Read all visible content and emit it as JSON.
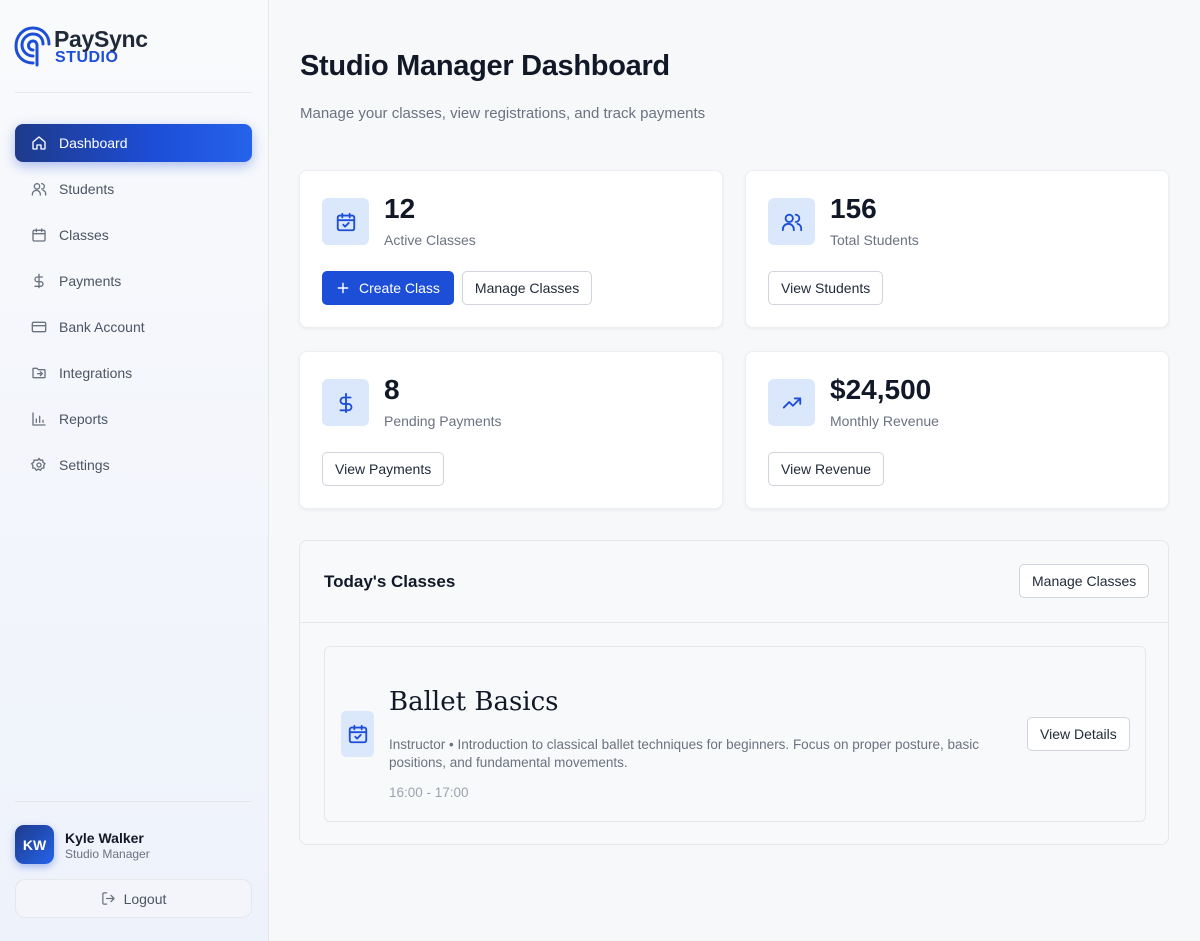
{
  "brand": {
    "name": "PaySync",
    "sub": "STUDIO",
    "accent": "#1d4ed8"
  },
  "sidebar": {
    "items": [
      {
        "label": "Dashboard",
        "icon": "home-icon",
        "active": true
      },
      {
        "label": "Students",
        "icon": "users-icon"
      },
      {
        "label": "Classes",
        "icon": "calendar-icon"
      },
      {
        "label": "Payments",
        "icon": "dollar-icon"
      },
      {
        "label": "Bank Account",
        "icon": "credit-card-icon"
      },
      {
        "label": "Integrations",
        "icon": "folder-icon"
      },
      {
        "label": "Reports",
        "icon": "bar-chart-icon"
      },
      {
        "label": "Settings",
        "icon": "gear-icon"
      }
    ]
  },
  "user": {
    "initials": "KW",
    "name": "Kyle Walker",
    "role": "Studio Manager",
    "logout_label": "Logout"
  },
  "header": {
    "title": "Studio Manager Dashboard",
    "subtitle": "Manage your classes, view registrations, and track payments"
  },
  "stats": {
    "classes": {
      "value": "12",
      "label": "Active Classes",
      "create_label": "Create Class",
      "manage_label": "Manage Classes"
    },
    "students": {
      "value": "156",
      "label": "Total Students",
      "view_label": "View Students"
    },
    "payments": {
      "value": "8",
      "label": "Pending Payments",
      "view_label": "View Payments"
    },
    "revenue": {
      "value": "$24,500",
      "label": "Monthly Revenue",
      "view_label": "View Revenue"
    }
  },
  "today": {
    "title": "Today's Classes",
    "manage_label": "Manage Classes",
    "classes": [
      {
        "title": "Ballet Basics",
        "description": "Instructor • Introduction to classical ballet techniques for beginners. Focus on proper posture, basic positions, and fundamental movements.",
        "time": "16:00 - 17:00",
        "details_label": "View Details"
      }
    ]
  }
}
